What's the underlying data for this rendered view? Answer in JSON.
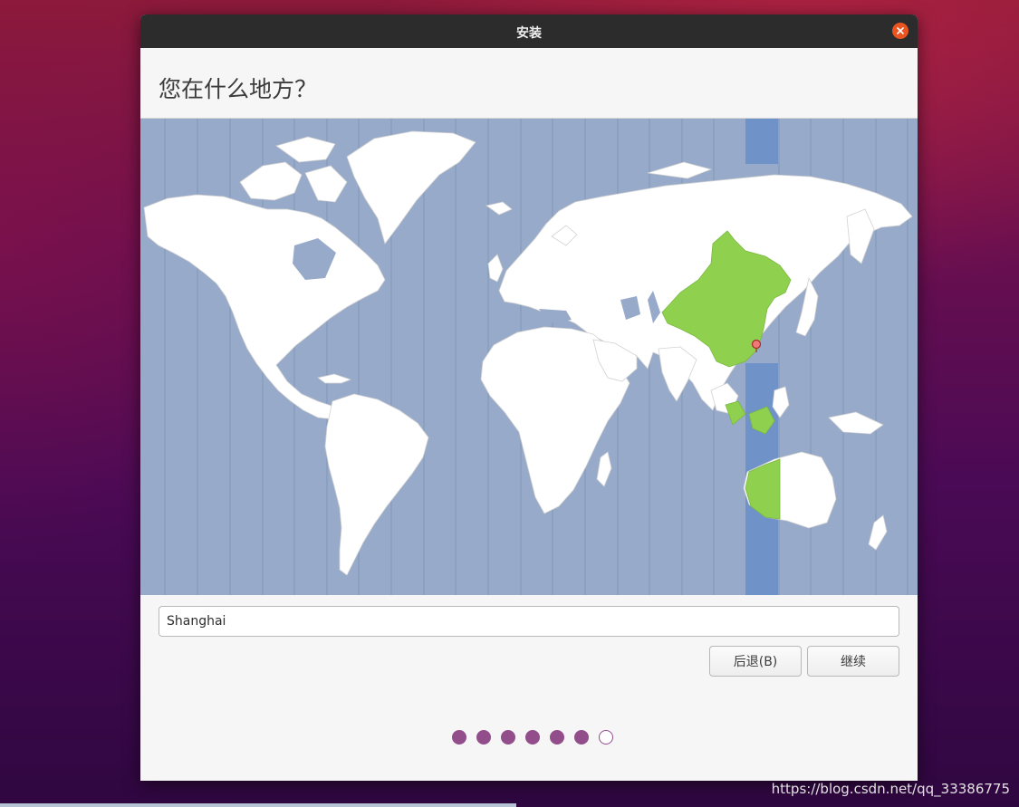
{
  "window": {
    "title": "安装",
    "page_title": "您在什么地方？"
  },
  "map": {
    "selected_timezone_color": "#6f93c8",
    "selected_region_color": "#8fd14f",
    "ocean_color": "#97aac9",
    "land_color": "#ffffff"
  },
  "location": {
    "value": "Shanghai"
  },
  "buttons": {
    "back_label": "后退(B)",
    "continue_label": "继续"
  },
  "progress": {
    "completed_steps": 6,
    "total_steps": 7
  },
  "watermark": "https://blog.csdn.net/qq_33386775",
  "colors": {
    "accent": "#e95420",
    "progress_dot": "#924d8b"
  }
}
